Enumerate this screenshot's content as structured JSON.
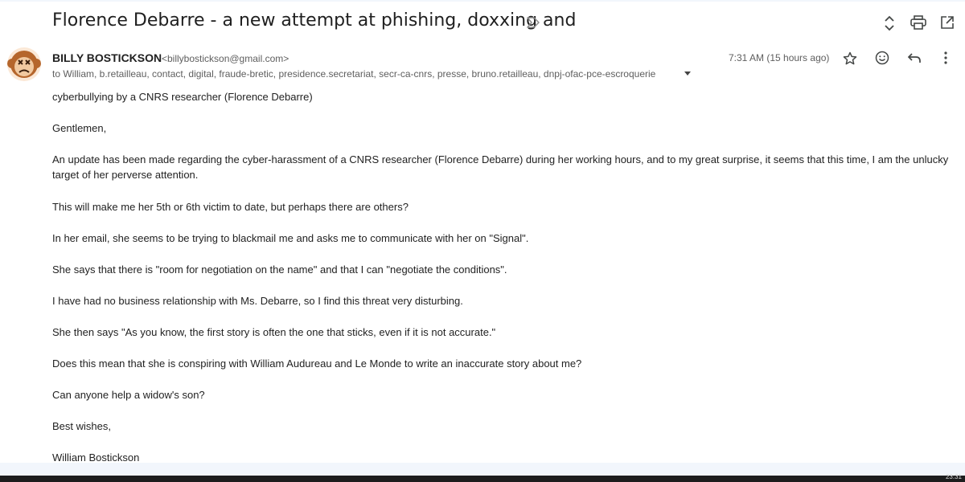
{
  "email": {
    "subject": "Florence Debarre - a new attempt at phishing, doxxing and",
    "sender_name": "BILLY BOSTICKSON",
    "sender_email": "<billybostickson@gmail.com>",
    "recipients": "to William, b.retailleau, contact, digital, fraude-bretic, presidence.secretariat, secr-ca-cnrs, presse, bruno.retailleau, dnpj-ofac-pce-escroquerie",
    "timestamp": "7:31 AM (15 hours ago)"
  },
  "body": {
    "p1": "cyberbullying by a CNRS researcher (Florence Debarre)",
    "p2": "Gentlemen,",
    "p3": "An update has been made regarding the cyber-harassment of a CNRS researcher (Florence Debarre) during her working hours, and to my great surprise, it seems that this time, I am the unlucky target of her perverse attention.",
    "p4": "This will make me her 5th or 6th victim to date, but perhaps there are others?",
    "p5": "In her email, she seems to be trying to blackmail me and asks me to communicate with her on \"Signal\".",
    "p6": "She says that there is \"room for negotiation on the name\" and that I can \"negotiate the conditions\".",
    "p7": "I have had no business relationship with Ms. Debarre, so I find this threat very disturbing.",
    "p8": "She then says \"As you know, the first story is often the one that sticks, even if it is not accurate.\"",
    "p9": "Does this mean that she is conspiring with William Audureau and Le Monde to write an inaccurate story about me?",
    "p10": "Can anyone help a widow's son?",
    "p11": "Best wishes,",
    "p12": "William Bostickson"
  },
  "taskbar": {
    "clock": "23:31"
  },
  "icons": {
    "label": "important-label-icon",
    "expand": "expand-collapse-icon",
    "print": "print-icon",
    "open_new": "open-in-new-window-icon",
    "star": "star-icon",
    "emoji": "emoji-reaction-icon",
    "reply": "reply-icon",
    "more": "more-vertical-icon"
  },
  "colors": {
    "text": "#202124",
    "muted": "#5e5e5e",
    "icon": "#444746"
  }
}
